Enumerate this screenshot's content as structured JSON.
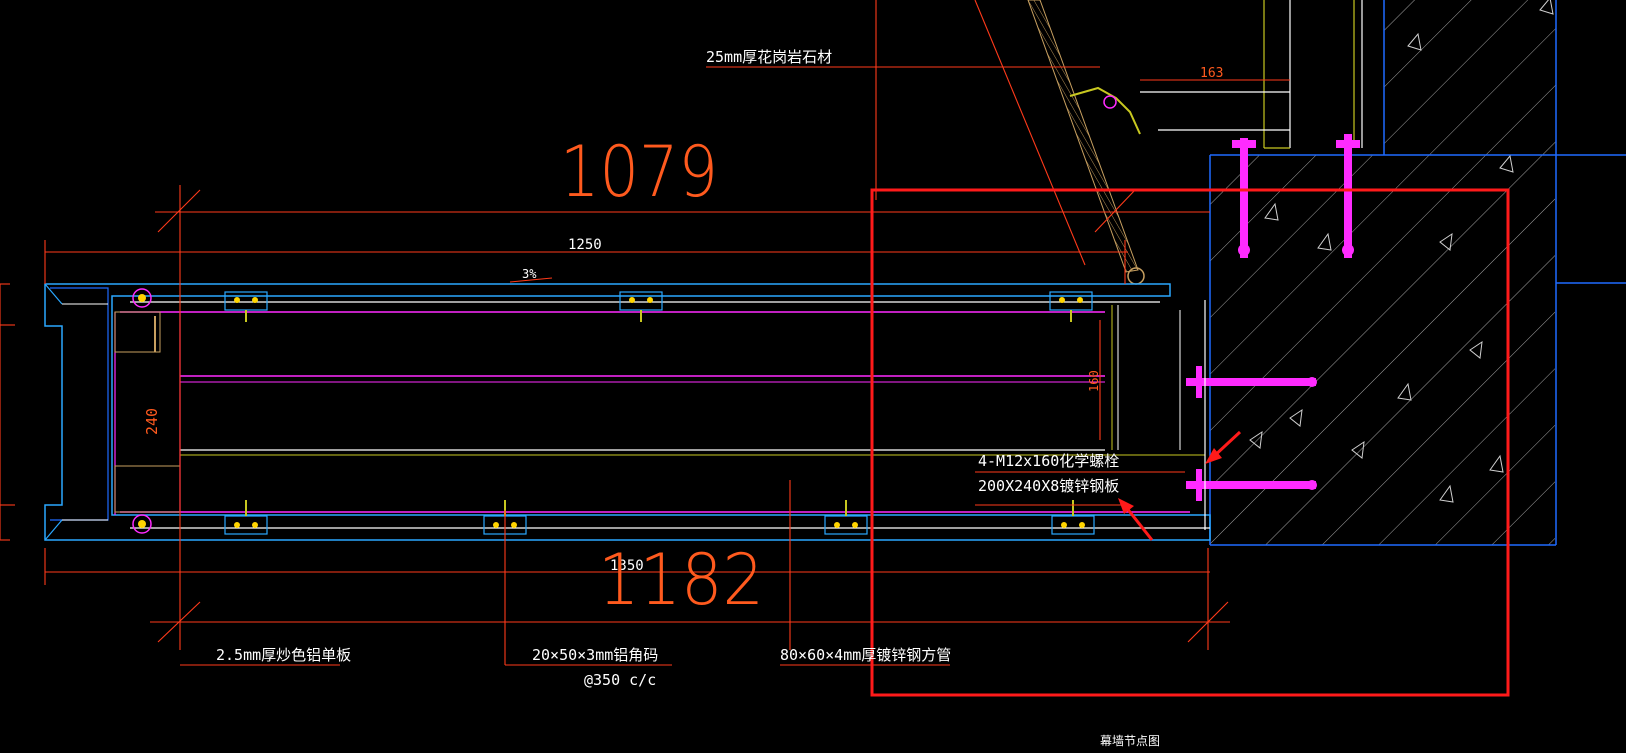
{
  "colors": {
    "background": "#000000",
    "dimension": "#ff3a1a",
    "outline_blue": "#1f6bff",
    "panel_blue": "#2aa8ff",
    "magenta": "#ff2bff",
    "white": "#ffffff",
    "orange_text": "#ff5a1e",
    "highlight_box": "#ff1a1a",
    "green": "#33ff66",
    "yellow": "#ffd400"
  },
  "labels": {
    "stone": "25mm厚花岗岩石材",
    "dim_163": "163",
    "big_1079": "1079",
    "dim_1250": "1250",
    "slope": "3%",
    "dim_240": "240",
    "dim_160": "160",
    "bolt": "4-M12x160化学螺栓",
    "plate": "200X240X8镀锌钢板",
    "dim_1350": "1350",
    "big_1182": "1182",
    "aluminum_panel": "2.5mm厚炒色铝单板",
    "angle": "20×50×3mm铝角码",
    "spacing": "@350 c/c",
    "tube": "80×60×4mm厚镀锌钢方管",
    "drawing_title": "幕墙节点图"
  }
}
